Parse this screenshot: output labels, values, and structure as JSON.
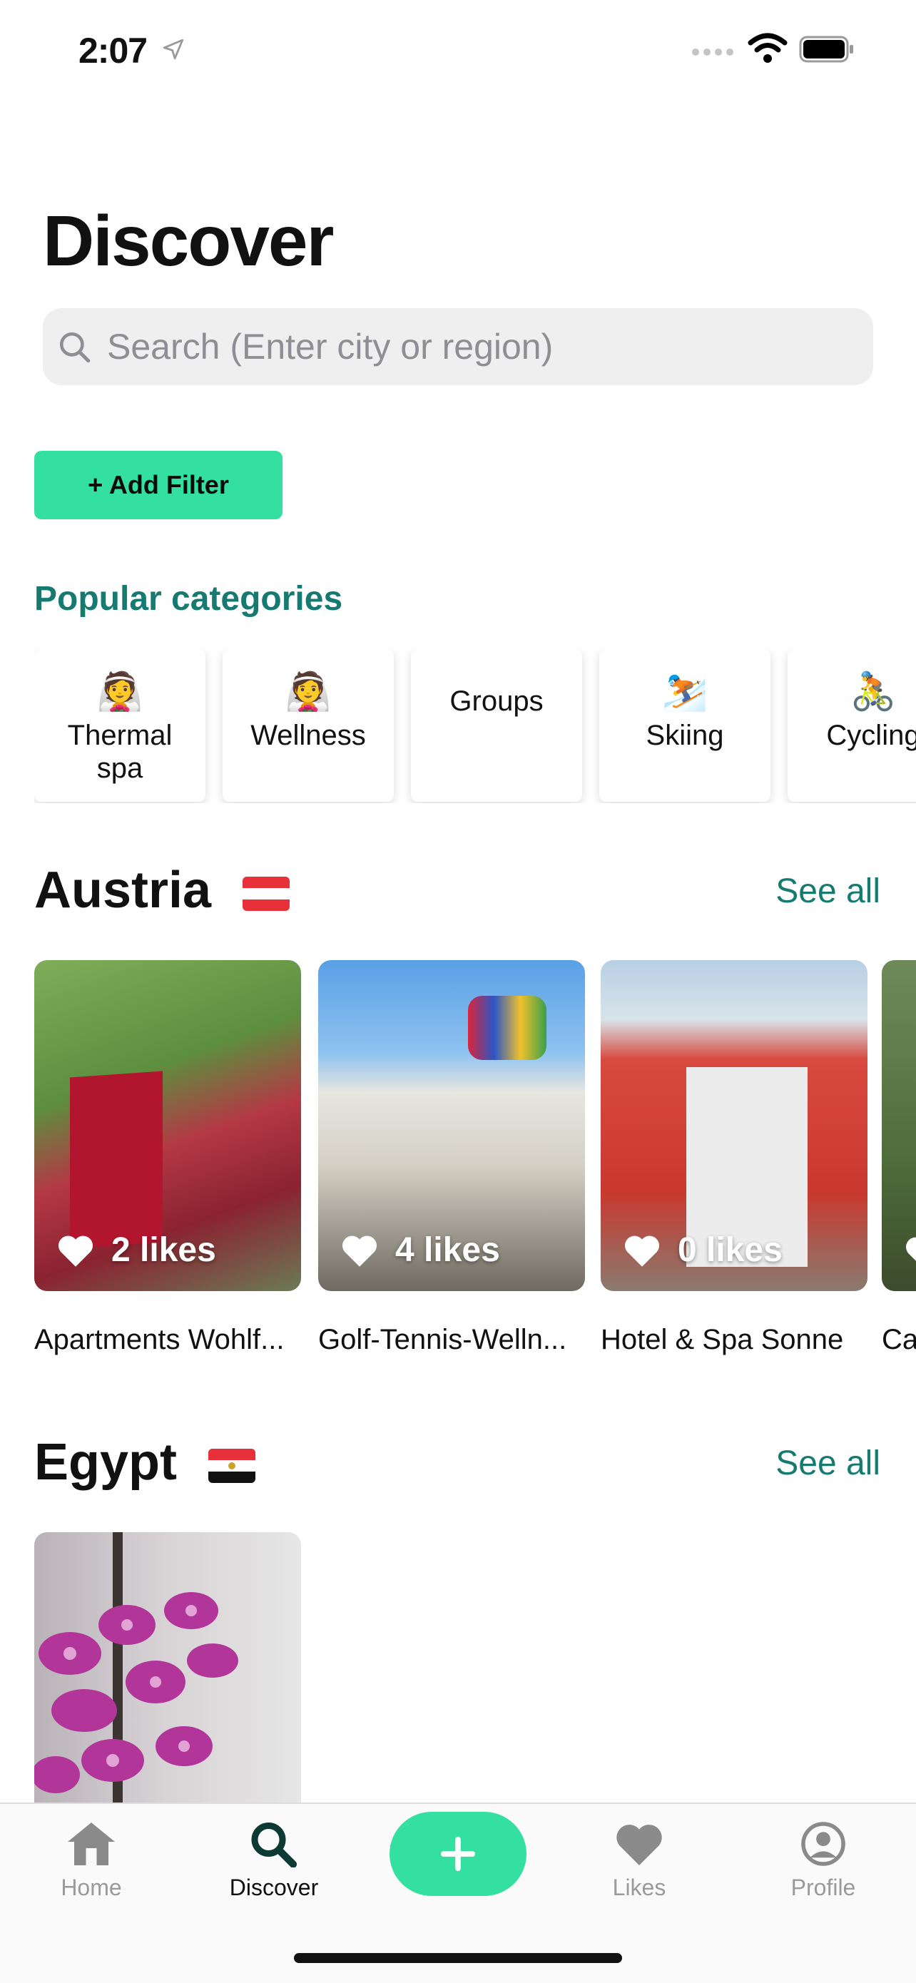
{
  "status_bar": {
    "time": "2:07"
  },
  "header": {
    "title": "Discover"
  },
  "search": {
    "placeholder": "Search (Enter city or region)"
  },
  "filter": {
    "label": "+ Add Filter"
  },
  "categories_section": {
    "title": "Popular categories",
    "items": [
      {
        "emoji": "👰",
        "label": "Thermal spa"
      },
      {
        "emoji": "👰",
        "label": "Wellness"
      },
      {
        "emoji": "",
        "label": "Groups"
      },
      {
        "emoji": "⛷️",
        "label": "Skiing"
      },
      {
        "emoji": "🚴",
        "label": "Cycling"
      }
    ]
  },
  "sections": [
    {
      "title": "Austria",
      "see_all": "See all",
      "cards": [
        {
          "likes": "2 likes",
          "title": "Apartments Wohlf..."
        },
        {
          "likes": "4 likes",
          "title": "Golf-Tennis-Welln..."
        },
        {
          "likes": "0 likes",
          "title": "Hotel & Spa Sonne"
        },
        {
          "likes": "",
          "title": "Ca"
        }
      ]
    },
    {
      "title": "Egypt",
      "see_all": "See all",
      "cards": []
    }
  ],
  "tabbar": {
    "home": "Home",
    "discover": "Discover",
    "likes": "Likes",
    "profile": "Profile"
  },
  "colors": {
    "accent": "#33e0a1",
    "teal_text": "#177a70",
    "search_bg": "#efefef"
  }
}
